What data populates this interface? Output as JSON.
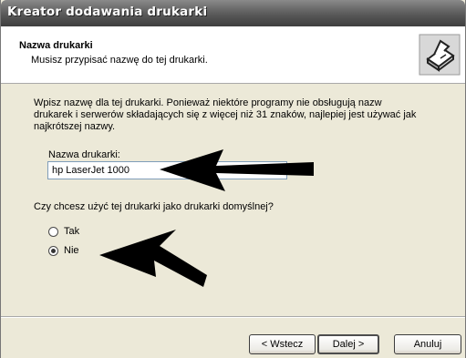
{
  "window": {
    "title": "Kreator dodawania drukarki"
  },
  "header": {
    "title": "Nazwa drukarki",
    "subtitle": "Musisz przypisać nazwę do tej drukarki.",
    "icon": "printer-icon"
  },
  "body": {
    "instructions_line1": "Wpisz nazwę dla tej drukarki. Ponieważ niektóre programy nie obsługują nazw",
    "instructions_line2": "drukarek i serwerów składających się z więcej niż 31 znaków, najlepiej jest używać jak",
    "instructions_line3": "najkrótszej nazwy.",
    "name_label": "Nazwa drukarki:",
    "name_value": "hp LaserJet 1000",
    "default_question": "Czy chcesz użyć tej drukarki jako drukarki domyślnej?",
    "options": [
      {
        "label": "Tak",
        "selected": false
      },
      {
        "label": "Nie",
        "selected": true
      }
    ]
  },
  "footer": {
    "back_label": "< Wstecz",
    "next_label": "Dalej >",
    "cancel_label": "Anuluj"
  }
}
